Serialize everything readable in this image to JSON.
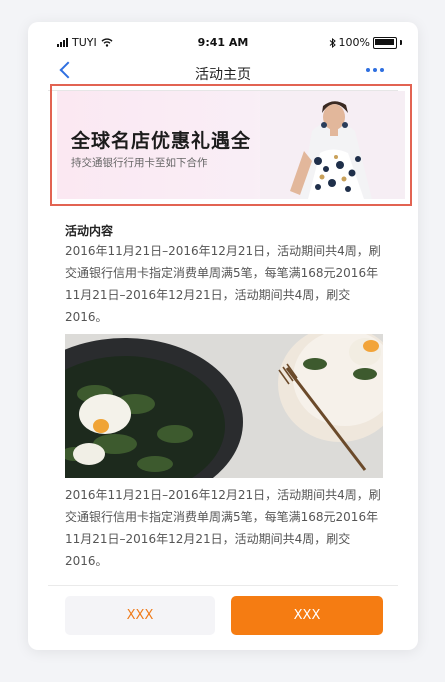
{
  "status_bar": {
    "carrier": "TUYI",
    "time": "9:41 AM",
    "battery": "100%"
  },
  "nav": {
    "title": "活动主页"
  },
  "banner": {
    "title": "全球名店优惠礼遇全",
    "subtitle": "持交通银行行用卡至如下合作"
  },
  "content": {
    "section_title": "活动内容",
    "paragraph_1": "2016年11月21日–2016年12月21日，活动期间共4周，刷交通银行信用卡指定消费单周满5笔，每笔满168元2016年11月21日–2016年12月21日，活动期间共4周，刷交2016。",
    "paragraph_2": "2016年11月21日–2016年12月21日，活动期间共4周，刷交通银行信用卡指定消费单周满5笔，每笔满168元2016年11月21日–2016年12月21日，活动期间共4周，刷交2016。"
  },
  "footer": {
    "secondary_label": "XXX",
    "primary_label": "XXX"
  },
  "colors": {
    "accent": "#f57c12",
    "link": "#2f6fe0",
    "highlight_border": "#e26352"
  }
}
